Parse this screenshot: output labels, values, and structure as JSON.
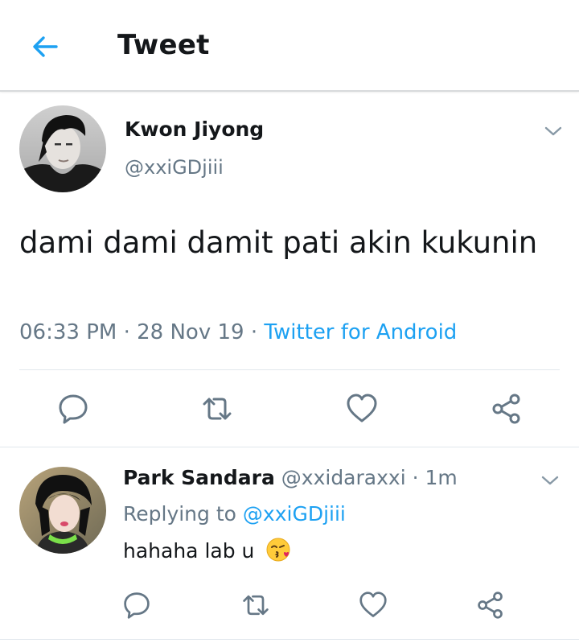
{
  "header": {
    "title": "Tweet",
    "back_icon": "arrow-left-icon",
    "accent": "#1da1f2"
  },
  "tweet": {
    "author_name": "Kwon Jiyong",
    "author_handle": "@xxiGDjiii",
    "text": "dami dami damit pati akin kukunin",
    "time": "06:33 PM",
    "date": "28 Nov 19",
    "source": "Twitter for Android",
    "actions": [
      "reply-icon",
      "retweet-icon",
      "like-icon",
      "share-icon"
    ]
  },
  "reply": {
    "author_name": "Park Sandara",
    "author_handle": "@xxidaraxxi",
    "time": "1m",
    "replying_prefix": "Replying to",
    "replying_to": "@xxiGDjiii",
    "text": "hahaha lab u",
    "emoji": "kissing-face-emoji",
    "actions": [
      "reply-icon",
      "retweet-icon",
      "like-icon",
      "share-icon"
    ]
  },
  "colors": {
    "text": "#14171a",
    "muted": "#657786",
    "link": "#1da1f2",
    "divider": "#e1e8ed"
  }
}
